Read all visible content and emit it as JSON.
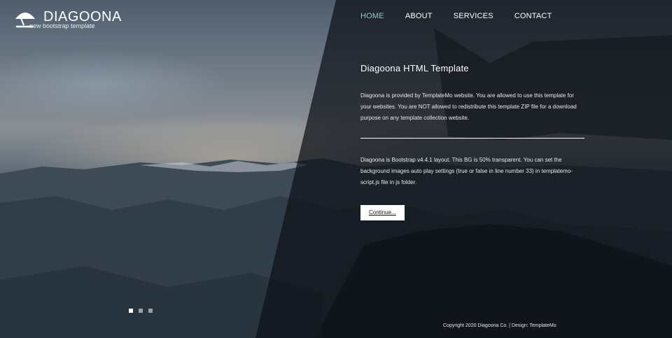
{
  "brand": {
    "title": "DIAGOONA",
    "subtitle": "new bootstrap template",
    "icon": "beach-umbrella-icon"
  },
  "nav": {
    "items": [
      {
        "label": "HOME",
        "active": true
      },
      {
        "label": "ABOUT",
        "active": false
      },
      {
        "label": "SERVICES",
        "active": false
      },
      {
        "label": "CONTACT",
        "active": false
      }
    ],
    "active_color": "#8fc6cf"
  },
  "main": {
    "title": "Diagoona HTML Template",
    "paragraph1": "Diagoona is provided by TemplateMo website. You are allowed to use this template for your websites. You are NOT allowed to redistribute this template ZIP file for a download purpose on any template collection website.",
    "paragraph2": "Diagoona is Bootstrap v4.4.1 layout. This BG is 50% transparent. You can set the background images auto play settings (true or false in line number 33) in templatemo-script.js file in js folder.",
    "button_label": "Continue..."
  },
  "slider": {
    "dot_count": 3,
    "active_index": 0
  },
  "footer": {
    "copyright": "Copyright 2020 Diagoona Co. | Design: TemplateMo"
  }
}
